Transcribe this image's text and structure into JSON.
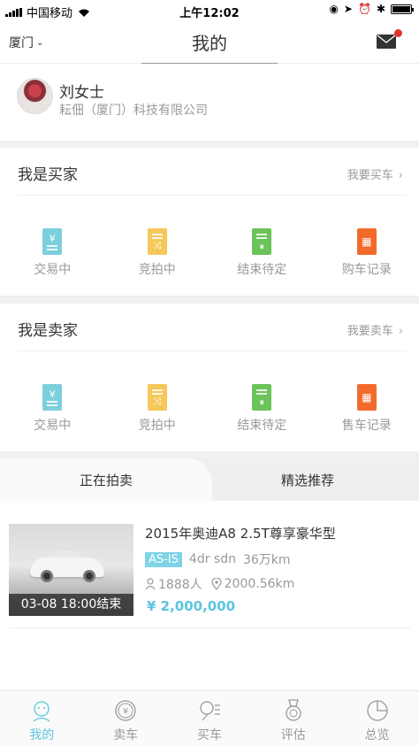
{
  "status_bar": {
    "carrier": "中国移动",
    "time": "上午12:02"
  },
  "header": {
    "city": "厦门",
    "title": "我的"
  },
  "profile": {
    "name": "刘女士",
    "company": "耘佃（厦门）科技有限公司"
  },
  "buyer": {
    "title": "我是买家",
    "link": "我要买车",
    "items": [
      {
        "label": "交易中",
        "icon": "trading-doc-icon",
        "color": "#7ccfdc"
      },
      {
        "label": "竞拍中",
        "icon": "bidding-doc-icon",
        "color": "#f6c75a"
      },
      {
        "label": "结束待定",
        "icon": "pending-doc-icon",
        "color": "#6cc35a"
      },
      {
        "label": "购车记录",
        "icon": "purchase-record-icon",
        "color": "#f26b2a"
      }
    ]
  },
  "seller": {
    "title": "我是卖家",
    "link": "我要卖车",
    "items": [
      {
        "label": "交易中",
        "icon": "trading-doc-icon",
        "color": "#7ccfdc"
      },
      {
        "label": "竞拍中",
        "icon": "bidding-doc-icon",
        "color": "#f6c75a"
      },
      {
        "label": "结束待定",
        "icon": "pending-doc-icon",
        "color": "#6cc35a"
      },
      {
        "label": "售车记录",
        "icon": "sale-record-icon",
        "color": "#f26b2a"
      }
    ]
  },
  "tabs": {
    "active": "正在拍卖",
    "inactive": "精选推荐"
  },
  "listing": {
    "title": "2015年奥迪A8 2.5T尊享豪华型",
    "badge": "AS-IS",
    "spec_body": "4dr sdn",
    "spec_mileage": "36万km",
    "people": "1888人",
    "distance": "2000.56km",
    "price": "¥ 2,000,000",
    "end_time": "03-08 18:00结束"
  },
  "tabbar": [
    {
      "label": "我的",
      "icon": "person-icon",
      "active": true
    },
    {
      "label": "卖车",
      "icon": "yuan-coin-icon",
      "active": false
    },
    {
      "label": "买车",
      "icon": "magnifier-list-icon",
      "active": false
    },
    {
      "label": "评估",
      "icon": "medal-icon",
      "active": false
    },
    {
      "label": "总览",
      "icon": "pie-chart-icon",
      "active": false
    }
  ],
  "colors": {
    "accent": "#5bc5df",
    "badge": "#7fd3e6",
    "notify_dot": "#e4332a"
  }
}
